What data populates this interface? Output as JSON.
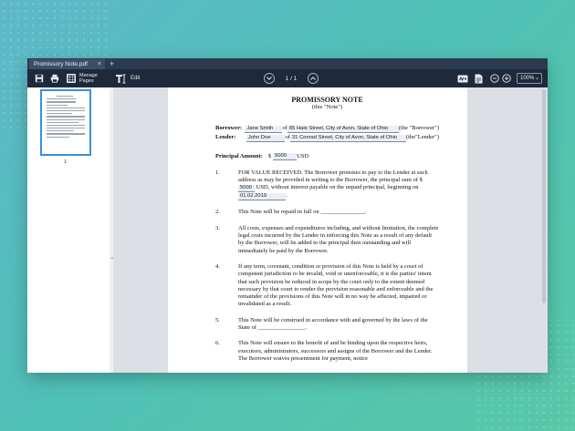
{
  "tab": {
    "title": "Promissory Note.pdf",
    "close": "×",
    "add": "+"
  },
  "toolbar": {
    "manage_pages_line1": "Manage",
    "manage_pages_line2": "Pages",
    "edit_label": "Edit",
    "page_indicator": "1 / 1",
    "zoom": "100%",
    "zoom_chevron": "⌄"
  },
  "sidebar": {
    "thumbnail_page_number": "1",
    "collapse_handle": "«"
  },
  "document": {
    "title": "PROMISSORY NOTE",
    "subtitle": "(this \"Note\")",
    "borrower_label": "Borrower:",
    "borrower_name": "Jane Smith",
    "of_text": "of",
    "borrower_address": "85 Hale Street, City of Avon, State of Ohio",
    "borrower_suffix": "(the \"Borrower\")",
    "lender_label": "Lender:",
    "lender_name": "John Doe",
    "lender_address": "31 Conrad Street, City of Avon, State of Ohio",
    "lender_suffix": "(the\"Lender\")",
    "principal_label": "Principal Amount:",
    "principal_currency": "$",
    "principal_value": "5000",
    "principal_unit": "USD",
    "p1_num": "1.",
    "p1_a": "FOR VALUE RECEIVED. The Borrower promises to pay to the Lender at such address as may be provided in writing to the Borrower, the principal sum of $",
    "p1_value": "5000",
    "p1_b": "USD, without interest payable on the unpaid principal, beginning on",
    "p1_date": "01.02.2019",
    "p1_c": ".",
    "p2_num": "2.",
    "p2_a": "This Note will be repaid in full on",
    "p2_blank": "_______________",
    "p2_b": ".",
    "p3_num": "3.",
    "p3": "All costs, expenses and expenditures including, and without limitation, the complete legal costs incurred by the Lender in enforcing this Note as a result of any default by the Borrower, will be added to the principal then outstanding and will immediately be paid by the Borrower.",
    "p4_num": "4.",
    "p4": "If any term, covenant, condition or provision of this Note is held by a court of competent jurisdiction to be invalid, void or unenforceable, it is the parties' intent that such provision be reduced in scope by the court only to the extent deemed necessary by that court to render the provision reasonable and enforceable and the remainder of the provisions of this Note will in no way be affected, impaired or invalidated as a result.",
    "p5_num": "5.",
    "p5_a": "This Note will be construed in accordance with and governed by the laws of the State of",
    "p5_blank": "________________",
    "p5_b": ".",
    "p6_num": "6.",
    "p6": "This Note will ensure to the benefit of and be binding upon the respective heirs, executors, administrators, successors and assigns of the Borrower and the Lender. The Borrower waives presentment for payment, notice"
  },
  "colors": {
    "toolbar": "#1e2a3b",
    "tabbar": "#2b3a4f",
    "accent": "#3a8fd9",
    "field_bg": "#e9eef7"
  }
}
